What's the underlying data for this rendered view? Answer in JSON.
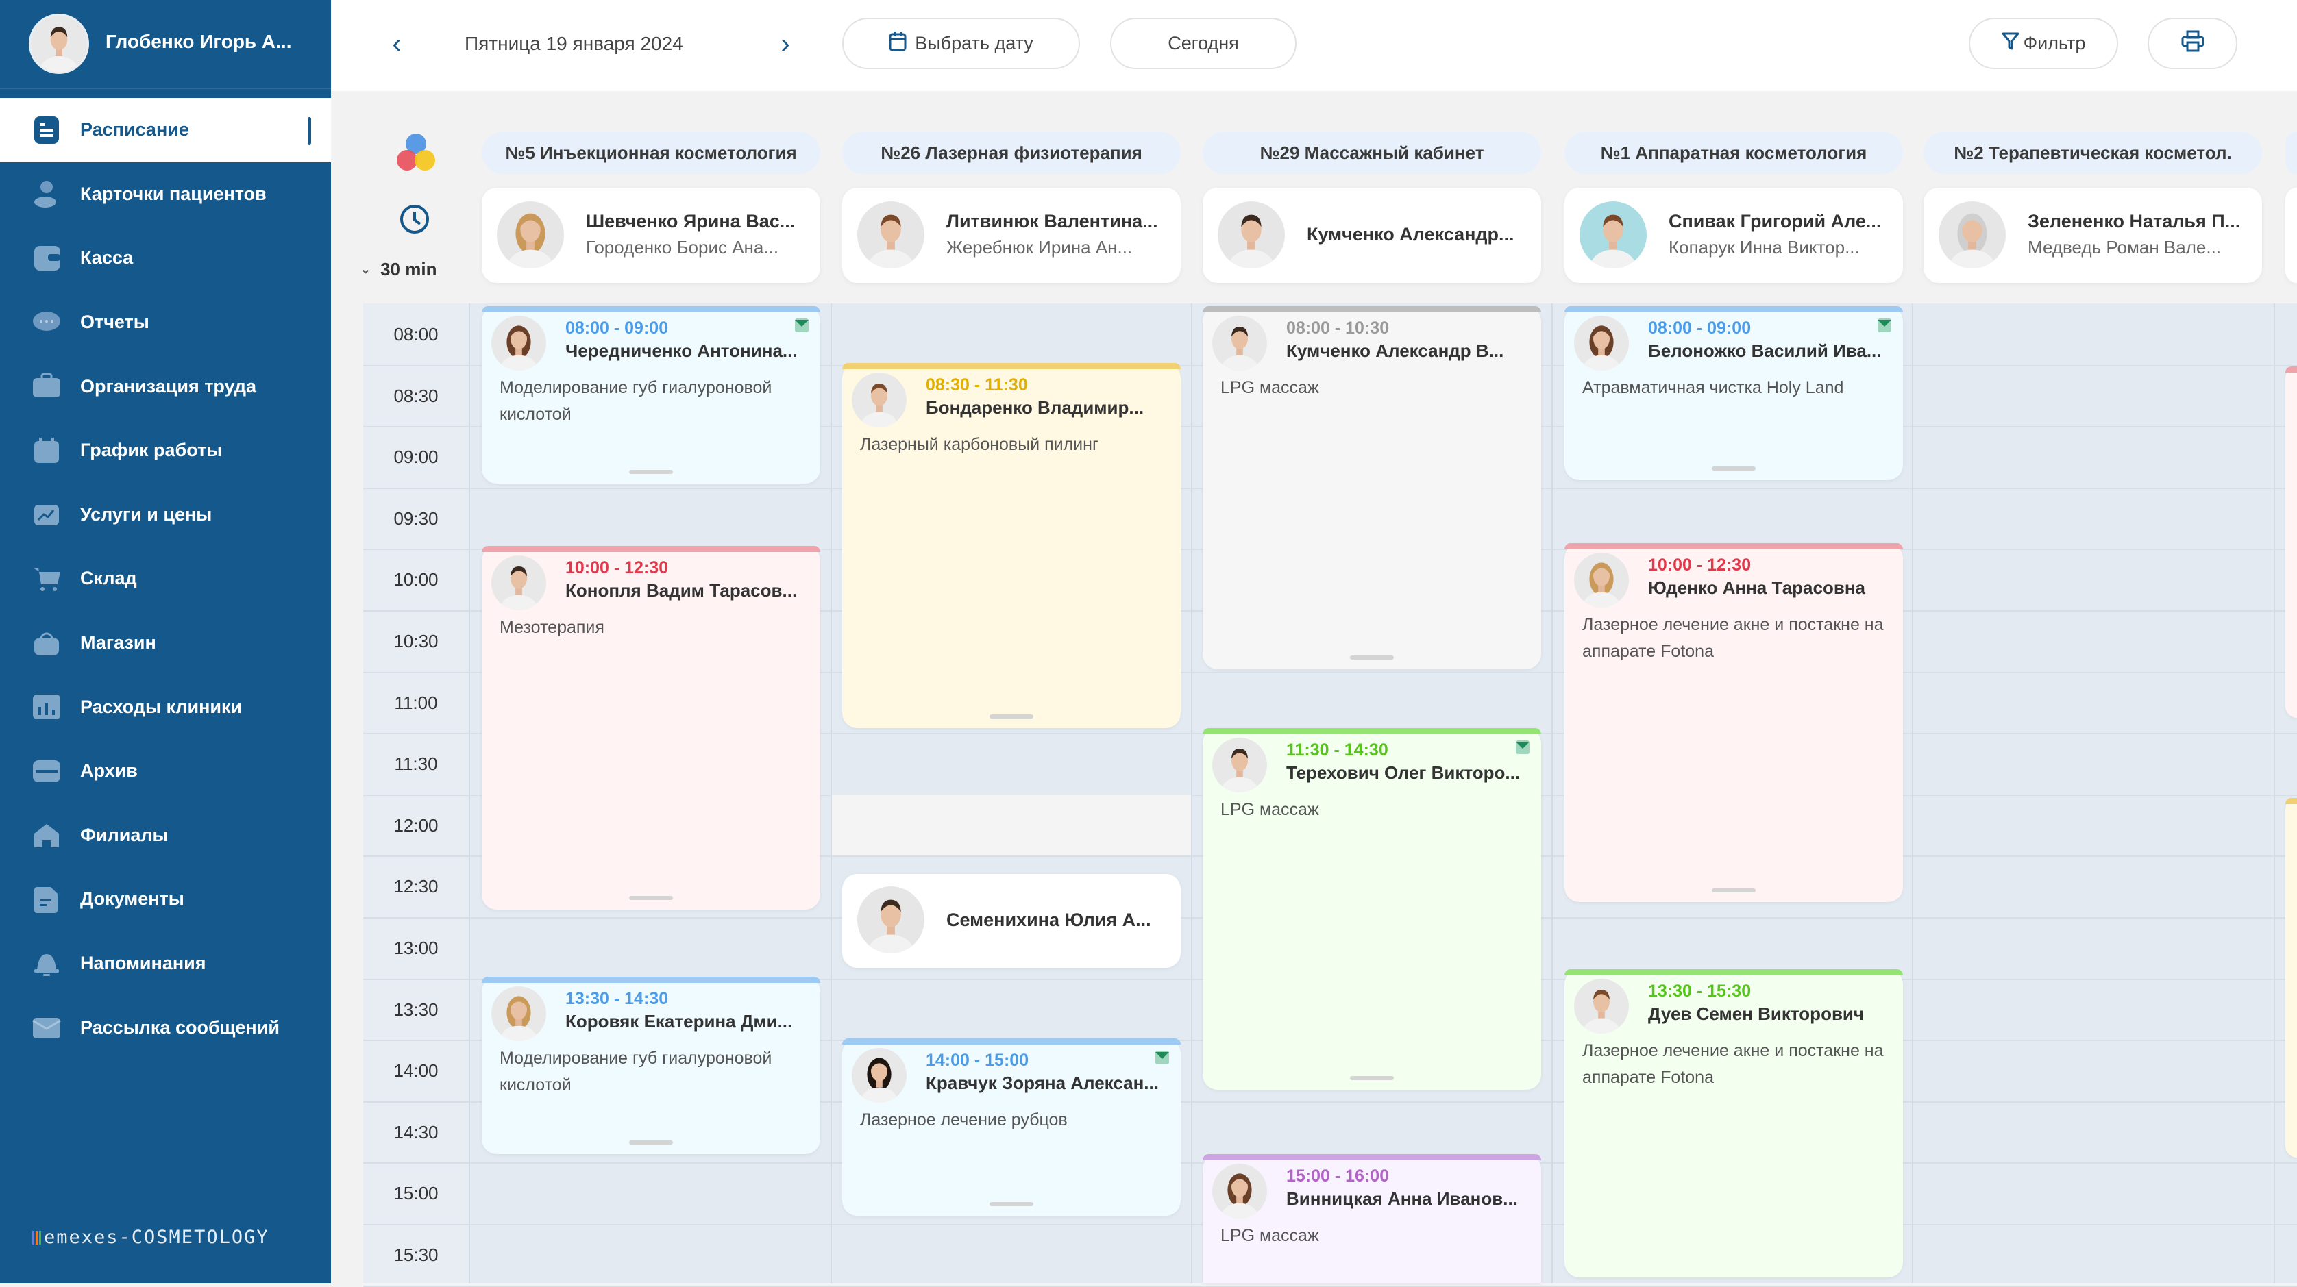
{
  "sidebar": {
    "user_name": "Глобенко Игорь А...",
    "items": [
      {
        "label": "Расписание",
        "icon": "schedule-icon",
        "active": true
      },
      {
        "label": "Карточки пациентов",
        "icon": "patients-icon"
      },
      {
        "label": "Касса",
        "icon": "wallet-icon"
      },
      {
        "label": "Отчеты",
        "icon": "chat-icon"
      },
      {
        "label": "Организация труда",
        "icon": "briefcase-icon"
      },
      {
        "label": "График работы",
        "icon": "calendar-icon"
      },
      {
        "label": "Услуги и цены",
        "icon": "chart-icon"
      },
      {
        "label": "Склад",
        "icon": "cart-icon"
      },
      {
        "label": "Магазин",
        "icon": "bag-icon"
      },
      {
        "label": "Расходы клиники",
        "icon": "bar-chart-icon"
      },
      {
        "label": "Архив",
        "icon": "folder-icon"
      },
      {
        "label": "Филиалы",
        "icon": "home-icon"
      },
      {
        "label": "Документы",
        "icon": "document-icon"
      },
      {
        "label": "Напоминания",
        "icon": "bell-icon"
      },
      {
        "label": "Рассылка сообщений",
        "icon": "mail-icon"
      }
    ],
    "logo": "emexes-COSMETOLOGY"
  },
  "header": {
    "date": "Пятница 19 января 2024",
    "pick_date": "Выбрать дату",
    "today": "Сегодня",
    "filter": "Фильтр"
  },
  "grid": {
    "interval": "30 min",
    "times": [
      "08:00",
      "08:30",
      "09:00",
      "09:30",
      "10:00",
      "10:30",
      "11:00",
      "11:30",
      "12:00",
      "12:30",
      "13:00",
      "13:30",
      "14:00",
      "14:30",
      "15:00",
      "15:30"
    ],
    "rooms": [
      {
        "name": "№5 Инъекционная косметология",
        "doctor": "Шевченко Ярина Вас...",
        "assistant": "Городенко Борис Ана..."
      },
      {
        "name": "№26 Лазерная физиотерапия",
        "doctor": "Литвинюк Валентина...",
        "assistant": "Жеребнюк Ирина Ан..."
      },
      {
        "name": "№29 Массажный кабинет",
        "doctor": "Кумченко Александр..."
      },
      {
        "name": "№1 Аппаратная косметология",
        "doctor": "Спивак Григорий Але...",
        "assistant": "Копарук Инна Виктор..."
      },
      {
        "name": "№2 Терапевтическая косметол.",
        "doctor": "Зелененко Наталья П...",
        "assistant": "Медведь Роман Вале..."
      }
    ],
    "inline_doctor": "Семенихина Юлия А..."
  },
  "appointments": [
    {
      "time": "08:00 - 09:00",
      "patient": "Чередниченко Антонина...",
      "service": "Моделирование губ гиалуроновой кислотой",
      "color": "blue",
      "confirmed": true
    },
    {
      "time": "10:00 - 12:30",
      "patient": "Конопля Вадим Тарасов...",
      "service": "Мезотерапия",
      "color": "red"
    },
    {
      "time": "13:30 - 14:30",
      "patient": "Коровяк Екатерина Дми...",
      "service": "Моделирование губ гиалуроновой кислотой",
      "color": "blue"
    },
    {
      "time": "08:30 - 11:30",
      "patient": "Бондаренко Владимир...",
      "service": "Лазерный карбоновый пилинг",
      "color": "yellow"
    },
    {
      "time": "14:00 - 15:00",
      "patient": "Кравчук Зоряна Алексан...",
      "service": "Лазерное лечение рубцов",
      "color": "blue",
      "confirmed": true
    },
    {
      "time": "08:00 - 10:30",
      "patient": "Кумченко Александр В...",
      "service": "LPG массаж",
      "color": "gray"
    },
    {
      "time": "11:30 - 14:30",
      "patient": "Терехович Олег Викторо...",
      "service": "LPG массаж",
      "color": "green",
      "confirmed": true
    },
    {
      "time": "15:00 - 16:00",
      "patient": "Винницкая Анна Иванов...",
      "service": "LPG массаж",
      "color": "purple"
    },
    {
      "time": "08:00 - 09:00",
      "patient": "Белоножко Василий Ива...",
      "service": "Атравматичная чистка Holy Land",
      "color": "blue",
      "confirmed": true
    },
    {
      "time": "10:00 - 12:30",
      "patient": "Юденко Анна Тарасовна",
      "service": "Лазерное лечение акне и постакне на аппарате Fotona",
      "color": "red"
    },
    {
      "time": "13:30 - 15:30",
      "patient": "Дуев Семен Викторович",
      "service": "Лазерное лечение акне и постакне на аппарате Fotona",
      "color": "green"
    }
  ],
  "colors": {
    "sidebar": "#15588c",
    "blue": "#4a9be8",
    "red": "#e0394b",
    "yellow": "#e2b000",
    "gray": "#999999",
    "green": "#56c41a",
    "purple": "#b362c8"
  }
}
